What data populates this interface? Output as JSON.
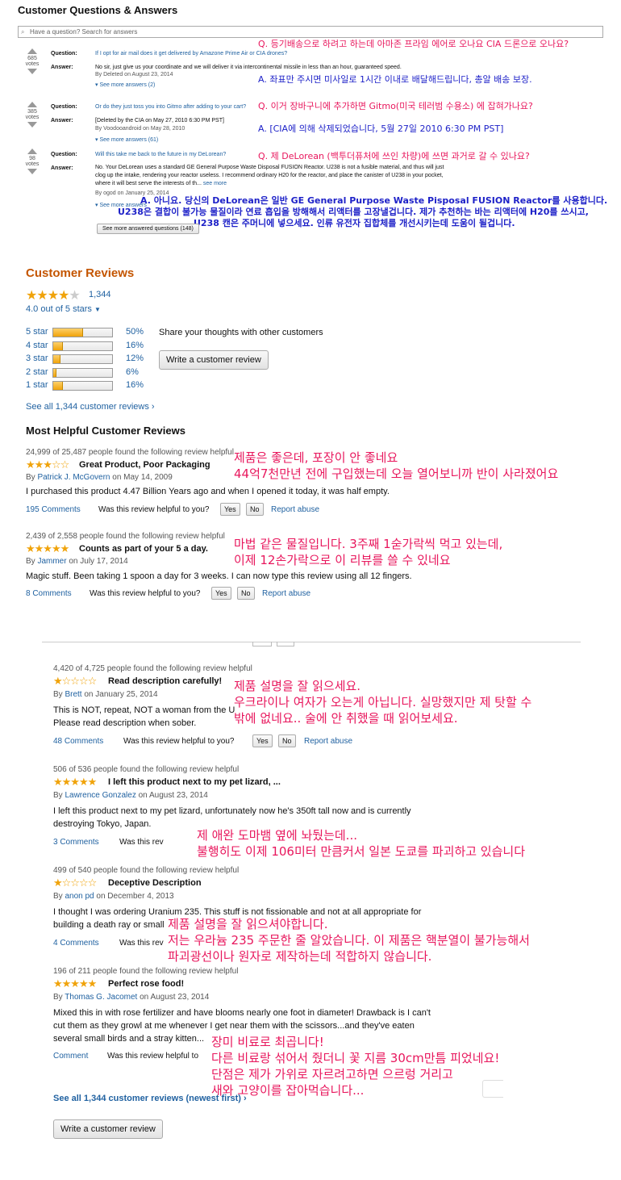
{
  "qa": {
    "title": "Customer Questions & Answers",
    "search_placeholder": "Have a question? Search for answers",
    "question_label": "Question:",
    "answer_label": "Answer:",
    "votes_label": "votes",
    "items": [
      {
        "votes": "685",
        "question": "If I opt for air mail does it get delivered by Amazone Prime Air or CIA drones?",
        "answer": "No sir, just give us your coordinate and we will deliver it via intercontinental missile in less than an hour, guaranteed speed.",
        "by": "By Deleted on August 23, 2014",
        "see_more": "See more answers (2)",
        "kr_q": "Q. 등기배송으로 하려고 하는데 아마존 프라임 에어로 오나요 CIA 드론으로 오나요?",
        "kr_a": "A. 좌표만 주시면 미사일로 1시간 이내로 배달해드립니다, 총알 배송 보장."
      },
      {
        "votes": "385",
        "question": "Or do they just toss you into Gitmo after adding to your cart?",
        "answer": "[Deleted by the CIA on May 27, 2010 6:30 PM PST]",
        "by": "By Voodooandroid on May 28, 2010",
        "see_more": "See more answers (61)",
        "kr_q": "Q. 이거 장바구니에 추가하면 Gitmo(미국 테러범 수용소) 에 잡혀가나요?",
        "kr_a": "A. [CIA에 의해 삭제되었습니다, 5월 27일 2010 6:30 PM PST]"
      },
      {
        "votes": "98",
        "question": "Will this take me back to the future in my DeLorean?",
        "answer_lines": [
          "No. Your DeLorean uses a standard GE General Purpose Waste Disposal FUSION Reactor. U238 is not a fusible material, and thus will just",
          "clog up the intake, rendering your reactor useless. I recommend ordinary H20 for the reactor, and place the canister of U238 in your pocket,",
          "where it will best serve the interests of th..."
        ],
        "see_more_inline": "see more",
        "by": "By ogod on January 25, 2014",
        "see_more": "See more answers",
        "kr_q": "Q. 제 DeLorean (백투더퓨처에 쓰인 차량)에 쓰면 과거로 갈 수 있나요?",
        "kr_a_lines": [
          "A. 아니요. 당신의 DeLorean은 일반 GE General Purpose Waste Pisposal FUSION Reactor를 사용합니다.",
          "U238은 결합이 불가능 물질이라 연료 흡입을 방해해서 리액터를 고장낼겁니다. 제가 추천하는 바는 리액터에 H20를 쓰시고,",
          "U238 캔은 주머니에 넣으세요. 인류 유전자 집합체를 개선시키는데 도움이 될겁니다."
        ]
      }
    ],
    "see_more_questions": "See more answered questions (148)"
  },
  "reviews": {
    "title": "Customer Reviews",
    "count": "1,344",
    "rating_text": "4.0 out of 5 stars",
    "histogram": [
      {
        "label": "5 star",
        "percent": 50,
        "text": "50%"
      },
      {
        "label": "4 star",
        "percent": 16,
        "text": "16%"
      },
      {
        "label": "3 star",
        "percent": 12,
        "text": "12%"
      },
      {
        "label": "2 star",
        "percent": 6,
        "text": "6%"
      },
      {
        "label": "1 star",
        "percent": 16,
        "text": "16%"
      }
    ],
    "share_text": "Share your thoughts with other customers",
    "write_review": "Write a customer review",
    "see_all": "See all 1,344 customer reviews",
    "most_helpful": "Most Helpful Customer Reviews",
    "helpful_question": "Was this review helpful to you?",
    "yes": "Yes",
    "no": "No",
    "report": "Report abuse",
    "items": [
      {
        "found": "24,999 of 25,487 people found the following review helpful",
        "stars": "★★★☆☆",
        "title": "Great Product, Poor Packaging",
        "by": "By",
        "author": "Patrick J. McGovern",
        "date": "on May 14, 2009",
        "body": "I purchased this product 4.47 Billion Years ago and when I opened it today, it was half empty.",
        "comments": "195 Comments",
        "kr": [
          "제품은 좋은데, 포장이 안 좋네요",
          "44억7천만년 전에 구입했는데 오늘 열어보니까 반이 사라졌어요"
        ]
      },
      {
        "found": "2,439 of 2,558 people found the following review helpful",
        "stars": "★★★★★",
        "title": "Counts as part of your 5 a day.",
        "by": "By",
        "author": "Jammer",
        "date": "on July 17, 2014",
        "body": "Magic stuff. Been taking 1 spoon a day for 3 weeks. I can now type this review using all 12 fingers.",
        "comments": "8 Comments",
        "kr": [
          "마법 같은 물질입니다. 3주째 1숟가락씩 먹고 있는데,",
          "이제 12손가락으로 이 리뷰를 쓸 수 있네요"
        ]
      },
      {
        "found": "4,420 of 4,725 people found the following review helpful",
        "stars": "★☆☆☆☆",
        "title": "Read description carefully!",
        "by": "By",
        "author": "Brett",
        "date": "on January 25, 2014",
        "body_lines": [
          "This is NOT, repeat, NOT a woman from the U",
          "Please read description when sober."
        ],
        "comments": "48 Comments",
        "kr": [
          "제품 설명을 잘 읽으세요.",
          "우크라이나 여자가 오는게 아닙니다. 실망했지만 제 탓할 수",
          "밖에 없네요.. 술에 안 취했을 때 읽어보세요."
        ]
      },
      {
        "found": "506 of 536 people found the following review helpful",
        "stars": "★★★★★",
        "title": "I left this product next to my pet lizard, ...",
        "by": "By",
        "author": "Lawrence Gonzalez",
        "date": "on August 23, 2014",
        "body_lines": [
          "I left this product next to my pet lizard, unfortunately now he's 350ft tall now and is currently",
          "destroying Tokyo, Japan."
        ],
        "comments": "3 Comments",
        "helpful_partial": "Was this rev",
        "kr": [
          "제 애완 도마뱀 옆에 놔뒀는데...",
          "불행히도 이제 106미터 만큼커서 일본 도쿄를 파괴하고 있습니다"
        ]
      },
      {
        "found": "499 of 540 people found the following review helpful",
        "stars": "★☆☆☆☆",
        "title": "Deceptive Description",
        "by": "By",
        "author": "anon pd",
        "date": "on December 4, 2013",
        "body_lines": [
          "I thought I was ordering Uranium 235. This stuff is not fissionable and not at all appropriate for",
          "building a death ray or small"
        ],
        "comments": "4 Comments",
        "helpful_partial": "Was this rev",
        "kr": [
          "제품 설명을 잘 읽으셔야합니다.",
          "저는 우라늄 235 주문한 줄 알았습니다. 이 제품은 핵분열이 불가능해서",
          "파괴광선이나 원자로 제작하는데 적합하지 않습니다."
        ]
      },
      {
        "found": "196 of 211 people found the following review helpful",
        "stars": "★★★★★",
        "title": "Perfect rose food!",
        "by": "By",
        "author": "Thomas G. Jacomet",
        "date": "on August 23, 2014",
        "body_lines": [
          "Mixed this in with rose fertilizer and have blooms nearly one foot in diameter! Drawback is I can't",
          "cut them as they growl at me whenever I get near them with the scissors...and they've eaten",
          "several small birds and a stray kitten..."
        ],
        "comments": "Comment",
        "helpful_partial": "Was this review helpful to",
        "kr": [
          "장미 비료로 최곱니다!",
          "다른 비료랑 섞어서 줬더니 꽃 지름 30cm만틈 피었네요!",
          "단점은 제가 가위로 자르려고하면 으르렁 거리고",
          "새와 고양이를 잡아먹습니다..."
        ]
      }
    ],
    "see_all_newest": "See all 1,344 customer reviews (newest first)",
    "write_review_bottom": "Write a customer review"
  }
}
